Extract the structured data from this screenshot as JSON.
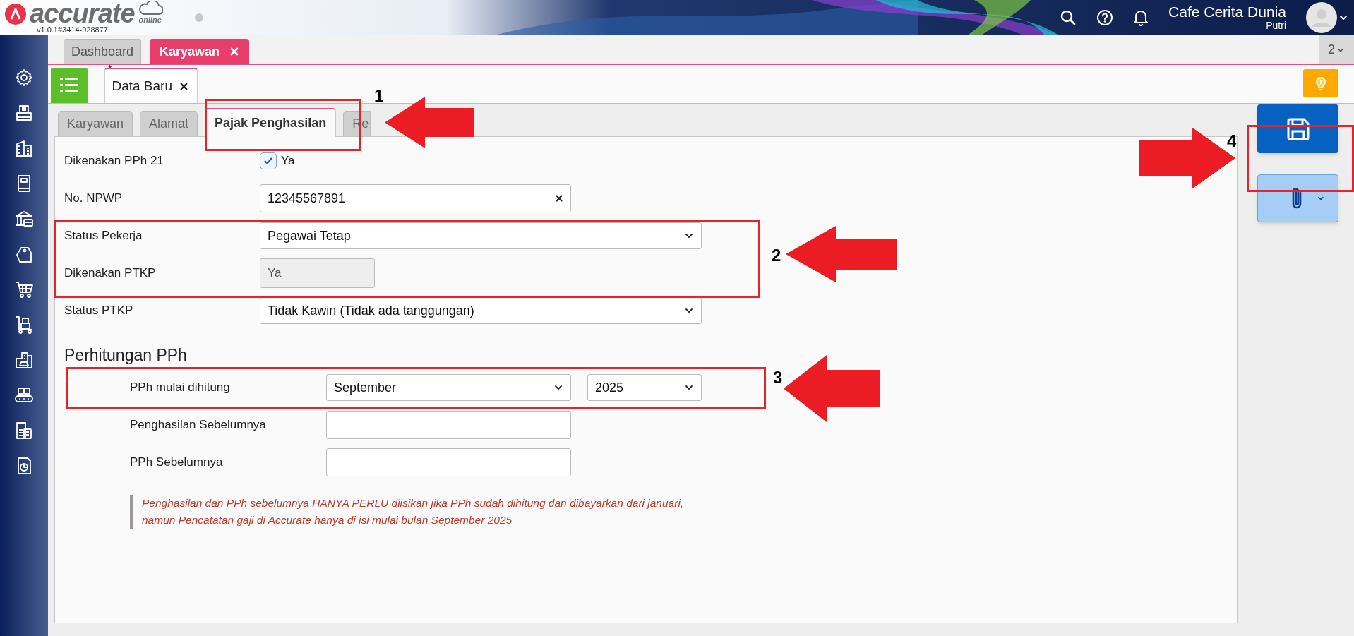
{
  "app": {
    "logo": "accurate",
    "logo_sub": "online",
    "version": "v1.0.1#3414-928877"
  },
  "header": {
    "company": "Cafe Cerita Dunia",
    "user": "Putri"
  },
  "tabs": [
    {
      "label": "Dashboard",
      "selected": false,
      "closable": false
    },
    {
      "label": "Karyawan",
      "selected": true,
      "closable": true
    }
  ],
  "tab_count": "2",
  "doc_tab": {
    "marker": "*",
    "label": "Data Baru"
  },
  "form_tabs": [
    {
      "label": "Karyawan",
      "selected": false
    },
    {
      "label": "Alamat",
      "selected": false
    },
    {
      "label": "Pajak Penghasilan",
      "selected": true
    },
    {
      "label": "Re",
      "selected": false
    }
  ],
  "fields": [
    {
      "kind": "checkbox",
      "label": "Dikenakan PPh 21",
      "text": "Ya",
      "checked": true
    },
    {
      "kind": "input",
      "label": "No. NPWP",
      "value": "12345567891",
      "clearable": true
    },
    {
      "kind": "select",
      "label": "Status Pekerja",
      "value": "Pegawai Tetap"
    },
    {
      "kind": "readonly",
      "label": "Dikenakan PTKP",
      "value": "Ya"
    },
    {
      "kind": "select",
      "label": "Status PTKP",
      "value": "Tidak Kawin (Tidak ada tanggungan)"
    }
  ],
  "section": {
    "title": "Perhitungan PPh",
    "fields": [
      {
        "kind": "month_year",
        "label": "PPh mulai dihitung",
        "month": "September",
        "year": "2025"
      },
      {
        "kind": "input",
        "label": "Penghasilan Sebelumnya"
      },
      {
        "kind": "input",
        "label": "PPh Sebelumnya"
      }
    ],
    "note": "Penghasilan dan PPh sebelumnya HANYA PERLU diisikan jika PPh sudah dihitung dan dibayarkan dari januari, namun Pencatatan gaji di Accurate hanya di isi mulai bulan September 2025"
  },
  "annotations": [
    {
      "number": "1"
    },
    {
      "number": "2"
    },
    {
      "number": "3"
    },
    {
      "number": "4"
    }
  ]
}
